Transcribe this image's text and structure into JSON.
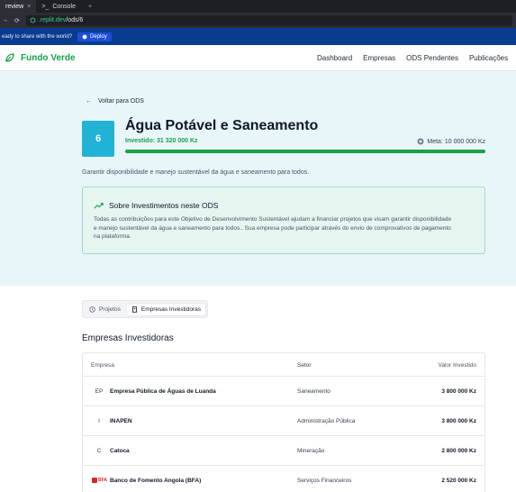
{
  "browser": {
    "tabs": [
      {
        "label": "review",
        "close": "×",
        "active": true
      },
      {
        "label": "Console",
        "prefix": ">_",
        "active": false
      }
    ],
    "new_tab": "+",
    "url_host": ".replit.dev",
    "url_path": "/ods/6",
    "banner_text": "eady to share with the world?",
    "deploy_label": "Deploy"
  },
  "header": {
    "brand": "Fundo Verde",
    "nav": [
      "Dashboard",
      "Empresas",
      "ODS Pendentes",
      "Publicações"
    ]
  },
  "hero": {
    "back_label": "Voltar para ODS",
    "number": "6",
    "title": "Água Potável e Saneamento",
    "invested": "Investido: 31 320 000 Kz",
    "goal": "Meta: 10 000 000 Kz",
    "progress_fraction": 1.0,
    "description": "Garantir disponibilidade e manejo sustentável da água e saneamento para todos.",
    "info_title": "Sobre Investimentos neste ODS",
    "info_body": "Todas as contribuições para este Objetivo de Desenvolvimento Sustentável ajudam a financiar projetos que visam garantir disponibilidade e manejo sustentável da água e saneamento para todos.. Sua empresa pode participar através do envio de comprovativos de pagamento na plataforma."
  },
  "tabs": [
    {
      "label": "Projetos",
      "active": false
    },
    {
      "label": "Empresas Investidoras",
      "active": true
    }
  ],
  "section_title": "Empresas Investidoras",
  "table": {
    "headers": {
      "company": "Empresa",
      "sector": "Setor",
      "value": "Valor Investido"
    },
    "rows": [
      {
        "abbr": "EP",
        "name": "Empresa Pública de Águas de Luanda",
        "sector": "Saneamento",
        "value": "3 800 000 Kz"
      },
      {
        "abbr": "I",
        "name": "INAPEN",
        "sector": "Administração Pública",
        "value": "3 800 000 Kz"
      },
      {
        "abbr": "C",
        "name": "Catoca",
        "sector": "Mineração",
        "value": "2 800 000 Kz"
      },
      {
        "abbr": "BFA",
        "name": "Banco de Fomento Angola (BFA)",
        "sector": "Serviços Financeiros",
        "value": "2 520 000 Kz"
      }
    ]
  },
  "colors": {
    "brand_green": "#16a34a",
    "ods_cyan": "#22b2d6",
    "hero_bg": "#e8f6f9",
    "info_bg": "#e5f5f0"
  }
}
